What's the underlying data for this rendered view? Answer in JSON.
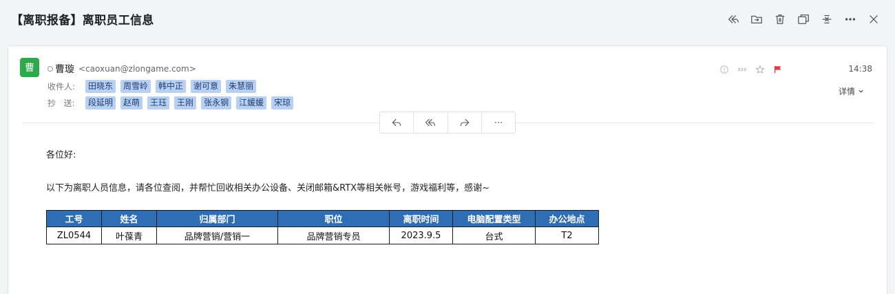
{
  "email": {
    "subject": "【离职报备】离职员工信息",
    "sender": {
      "avatar_char": "曹",
      "avatar_color": "#2ea84a",
      "name": "曹璇",
      "email": "<caoxuan@zlongame.com>"
    },
    "to_label": "收件人:",
    "to": [
      "田晓东",
      "周雪岭",
      "韩中正",
      "谢可意",
      "朱慧丽"
    ],
    "cc_label": "抄   送:",
    "cc": [
      "段延明",
      "赵萌",
      "王珏",
      "王刚",
      "张永钢",
      "江媛媛",
      "宋琼"
    ],
    "time": "14:38",
    "details_label": "详情",
    "flag_color": "#e03b3b"
  },
  "top_actions": [
    "reply-all-icon",
    "move-folder-icon",
    "delete-icon",
    "new-window-icon",
    "collapse-icon",
    "more-icon",
    "close-icon"
  ],
  "body": {
    "greeting": "各位好:",
    "intro": "以下为离职人员信息，请各位查阅，并帮忙回收相关办公设备、关闭邮箱&RTX等相关帐号，游戏福利等，感谢~",
    "table": {
      "header_color": "#2f6eb5",
      "headers": [
        "工号",
        "姓名",
        "归属部门",
        "职位",
        "离职时间",
        "电脑配置类型",
        "办公地点"
      ],
      "rows": [
        [
          "ZL0544",
          "叶葆青",
          "品牌营销/营销一",
          "品牌营销专员",
          "2023.9.5",
          "台式",
          "T2"
        ]
      ]
    }
  }
}
